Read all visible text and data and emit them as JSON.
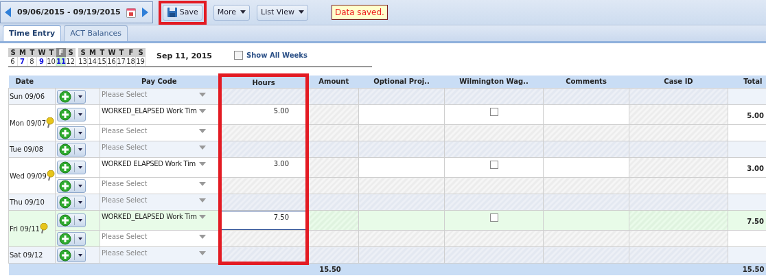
{
  "toolbar": {
    "date_range": "09/06/2015 - 09/19/2015",
    "buttons": [
      {
        "label": "Save",
        "kind": "save",
        "highlighted": true
      },
      {
        "label": "More",
        "kind": "menu"
      },
      {
        "label": "List View",
        "kind": "menu"
      }
    ],
    "status": "Data saved."
  },
  "tabs": [
    {
      "label": "Time Entry",
      "selected": true
    },
    {
      "label": "ACT Balances",
      "selected": false
    }
  ],
  "calendar": {
    "weeks": [
      {
        "days": [
          {
            "weekday": "S",
            "day": "6",
            "has_time": false,
            "selected": false
          },
          {
            "weekday": "M",
            "day": "7",
            "has_time": true,
            "selected": false
          },
          {
            "weekday": "T",
            "day": "8",
            "has_time": false,
            "selected": false
          },
          {
            "weekday": "W",
            "day": "9",
            "has_time": true,
            "selected": false
          },
          {
            "weekday": "T",
            "day": "10",
            "has_time": false,
            "selected": false
          },
          {
            "weekday": "F",
            "day": "11",
            "has_time": true,
            "selected": true
          },
          {
            "weekday": "S",
            "day": "12",
            "has_time": false,
            "selected": false
          }
        ]
      },
      {
        "days": [
          {
            "weekday": "S",
            "day": "13",
            "has_time": false,
            "selected": false
          },
          {
            "weekday": "M",
            "day": "14",
            "has_time": false,
            "selected": false
          },
          {
            "weekday": "T",
            "day": "15",
            "has_time": false,
            "selected": false
          },
          {
            "weekday": "W",
            "day": "16",
            "has_time": false,
            "selected": false
          },
          {
            "weekday": "T",
            "day": "17",
            "has_time": false,
            "selected": false
          },
          {
            "weekday": "F",
            "day": "18",
            "has_time": false,
            "selected": false
          },
          {
            "weekday": "S",
            "day": "19",
            "has_time": false,
            "selected": false
          }
        ]
      }
    ],
    "selected_date": "Sep 11, 2015",
    "show_all_weeks": {
      "label": "Show All Weeks",
      "checked": false
    }
  },
  "table": {
    "columns": [
      {
        "label": "Date"
      },
      {
        "label": "Pay Code"
      },
      {
        "label": "Hours",
        "highlighted": true
      },
      {
        "label": "Amount"
      },
      {
        "label": "Optional Proj.."
      },
      {
        "label": "Wilmington Wag.."
      },
      {
        "label": "Comments"
      },
      {
        "label": "Case ID"
      },
      {
        "label": "Total"
      }
    ],
    "days": [
      {
        "date": "Sun 09/06",
        "note": false,
        "selected": false,
        "entries": [
          {
            "kind": "blank",
            "placeholder": "Please Select"
          }
        ]
      },
      {
        "date": "Mon 09/07",
        "note": true,
        "selected": false,
        "entries": [
          {
            "kind": "entry",
            "pay_code": "WORKED_ELAPSED Work Tim",
            "hours": "5.00",
            "focused": false,
            "wage_checked": false,
            "total": "5.00"
          },
          {
            "kind": "blank",
            "placeholder": "Please Select"
          }
        ]
      },
      {
        "date": "Tue 09/08",
        "note": false,
        "selected": false,
        "entries": [
          {
            "kind": "blank",
            "placeholder": "Please Select"
          }
        ]
      },
      {
        "date": "Wed 09/09",
        "note": true,
        "selected": false,
        "entries": [
          {
            "kind": "entry",
            "pay_code": "WORKED ELAPSED Work Tim",
            "hours": "3.00",
            "focused": false,
            "wage_checked": false,
            "total": "3.00"
          },
          {
            "kind": "blank",
            "placeholder": "Please Select"
          }
        ]
      },
      {
        "date": "Thu 09/10",
        "note": false,
        "selected": false,
        "entries": [
          {
            "kind": "blank",
            "placeholder": "Please Select"
          }
        ]
      },
      {
        "date": "Fri 09/11",
        "note": true,
        "selected": true,
        "entries": [
          {
            "kind": "entry",
            "pay_code": "WORKED_ELAPSED Work Tim",
            "hours": "7.50",
            "focused": true,
            "wage_checked": false,
            "total": "7.50"
          },
          {
            "kind": "blank",
            "placeholder": "Please Select"
          }
        ]
      },
      {
        "date": "Sat 09/12",
        "note": false,
        "selected": false,
        "entries": [
          {
            "kind": "blank",
            "placeholder": "Please Select"
          }
        ]
      }
    ],
    "footer": {
      "hours_total": "15.50",
      "total": "15.50"
    }
  }
}
